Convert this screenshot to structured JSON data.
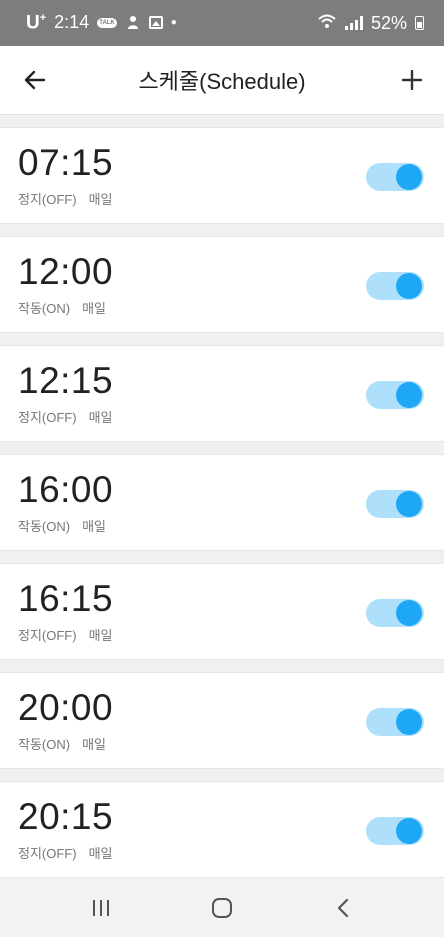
{
  "status_bar": {
    "carrier": "U",
    "carrier_sup": "+",
    "time": "2:14",
    "chat_badge": "TALK",
    "battery": "52%"
  },
  "header": {
    "title": "스케줄(Schedule)"
  },
  "schedules": [
    {
      "time": "07:15",
      "status": "정지(OFF)",
      "repeat": "매일",
      "enabled": true
    },
    {
      "time": "12:00",
      "status": "작동(ON)",
      "repeat": "매일",
      "enabled": true
    },
    {
      "time": "12:15",
      "status": "정지(OFF)",
      "repeat": "매일",
      "enabled": true
    },
    {
      "time": "16:00",
      "status": "작동(ON)",
      "repeat": "매일",
      "enabled": true
    },
    {
      "time": "16:15",
      "status": "정지(OFF)",
      "repeat": "매일",
      "enabled": true
    },
    {
      "time": "20:00",
      "status": "작동(ON)",
      "repeat": "매일",
      "enabled": true
    },
    {
      "time": "20:15",
      "status": "정지(OFF)",
      "repeat": "매일",
      "enabled": true
    }
  ],
  "colors": {
    "status_bar": "#7d7d7d",
    "toggle_track": "#aee0fb",
    "toggle_knob": "#1ea7f5"
  },
  "icons": {
    "back": "arrow-left-icon",
    "add": "plus-icon",
    "nav_recents": "recents-icon",
    "nav_home": "home-icon",
    "nav_back": "chevron-left-icon"
  }
}
